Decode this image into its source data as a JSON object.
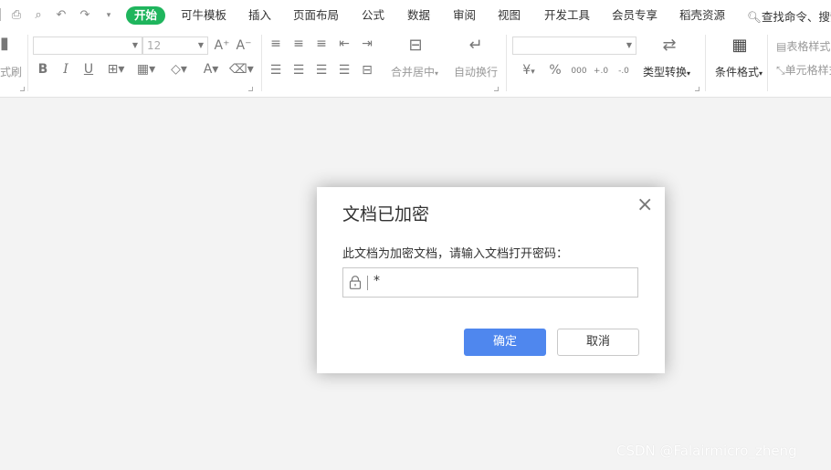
{
  "menubar": {
    "tabs": [
      {
        "label": "开始",
        "active": true
      },
      {
        "label": "可牛模板"
      },
      {
        "label": "插入"
      },
      {
        "label": "页面布局"
      },
      {
        "label": "公式"
      },
      {
        "label": "数据"
      },
      {
        "label": "审阅"
      },
      {
        "label": "视图"
      },
      {
        "label": "开发工具"
      },
      {
        "label": "会员专享"
      },
      {
        "label": "稻壳资源"
      }
    ],
    "search_label": "查找命令、搜索",
    "quick_access_icons": [
      "print-icon",
      "print-preview-icon",
      "undo-icon",
      "redo-icon",
      "more-dropdown-icon"
    ]
  },
  "ribbon": {
    "format_painter_label": "式刷",
    "font_name": "",
    "font_size": "12",
    "font_styles": [
      "B",
      "I",
      "U"
    ],
    "merge_center_label": "合并居中",
    "wrap_text_label": "自动换行",
    "number_format": "",
    "currency_symbol": "¥",
    "percent_symbol": "%",
    "thousands_symbol": "000",
    "increase_decimal_symbol": "+.0",
    "decrease_decimal_symbol": "-.0",
    "type_convert_label": "类型转换",
    "conditional_format_label": "条件格式",
    "table_style_label": "表格样式",
    "cell_style_label": "单元格样式"
  },
  "dialog": {
    "title": "文档已加密",
    "prompt": "此文档为加密文档，请输入文档打开密码：",
    "password_value": "*",
    "ok_label": "确定",
    "cancel_label": "取消",
    "close_symbol": "×"
  },
  "watermark": "CSDN @Falairmicro_zheng",
  "colors": {
    "active_tab": "#1fb55d",
    "primary_button": "#4f87ee",
    "workspace_bg": "#f3f3f3"
  }
}
